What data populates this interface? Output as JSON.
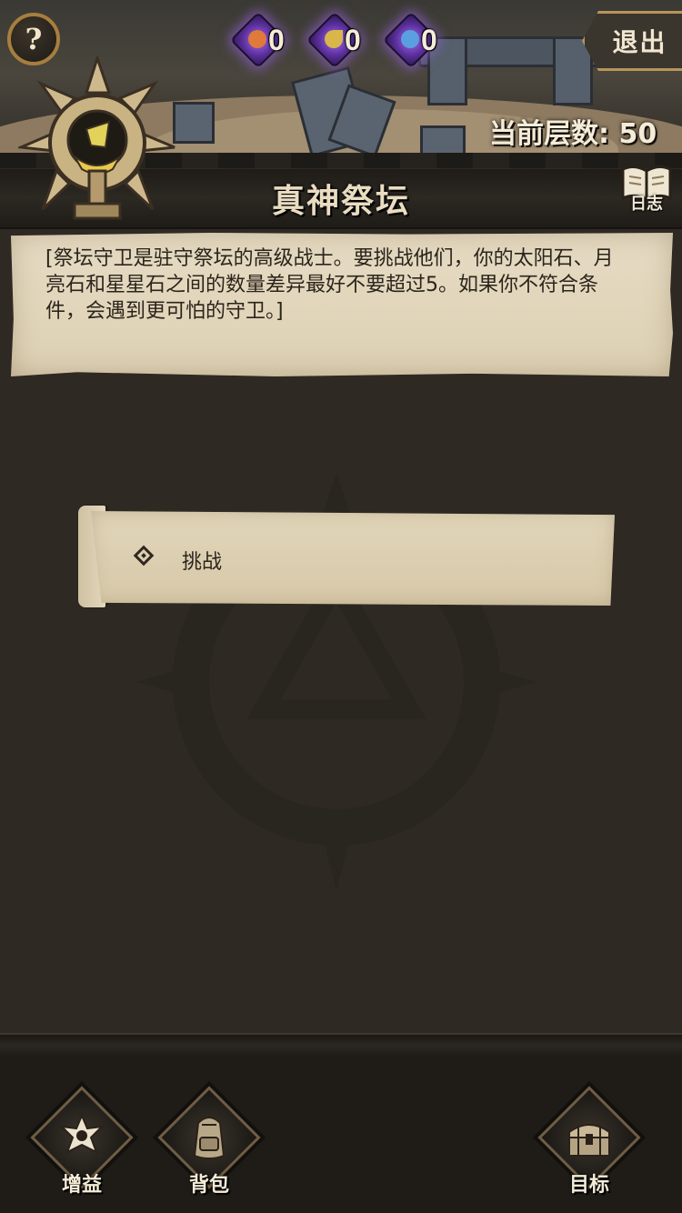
{
  "header": {
    "help_glyph": "?",
    "help_icon": "question-mark-icon",
    "stones": [
      {
        "name": "sun-stone-icon",
        "count": "0",
        "color": "#e07a3a"
      },
      {
        "name": "moon-stone-icon",
        "count": "0",
        "color": "#d9b64a"
      },
      {
        "name": "star-stone-icon",
        "count": "0",
        "color": "#5aa0e0"
      }
    ],
    "exit_label": "退出",
    "floor_label": "当前层数: 50"
  },
  "title_bar": {
    "title": "真神祭坛",
    "log_label": "日志",
    "log_icon": "book-icon"
  },
  "event": {
    "description": "[祭坛守卫是驻守祭坛的高级战士。要挑战他们，你的太阳石、月亮石和星星石之间的数量差异最好不要超过5。如果你不符合条件，会遇到更可怕的守卫。]",
    "choices": [
      {
        "label": "挑战",
        "icon": "diamond-icon"
      }
    ]
  },
  "bottom_nav": {
    "items": [
      {
        "label": "增益",
        "icon": "buff-emblem-icon"
      },
      {
        "label": "背包",
        "icon": "backpack-icon"
      },
      {
        "label": "目标",
        "icon": "treasure-chest-icon"
      }
    ]
  },
  "colors": {
    "background": "#2e2a23",
    "parchment": "#e2d6ba",
    "gold_trim": "#a77e3e",
    "text_light": "#f4ecd8"
  }
}
